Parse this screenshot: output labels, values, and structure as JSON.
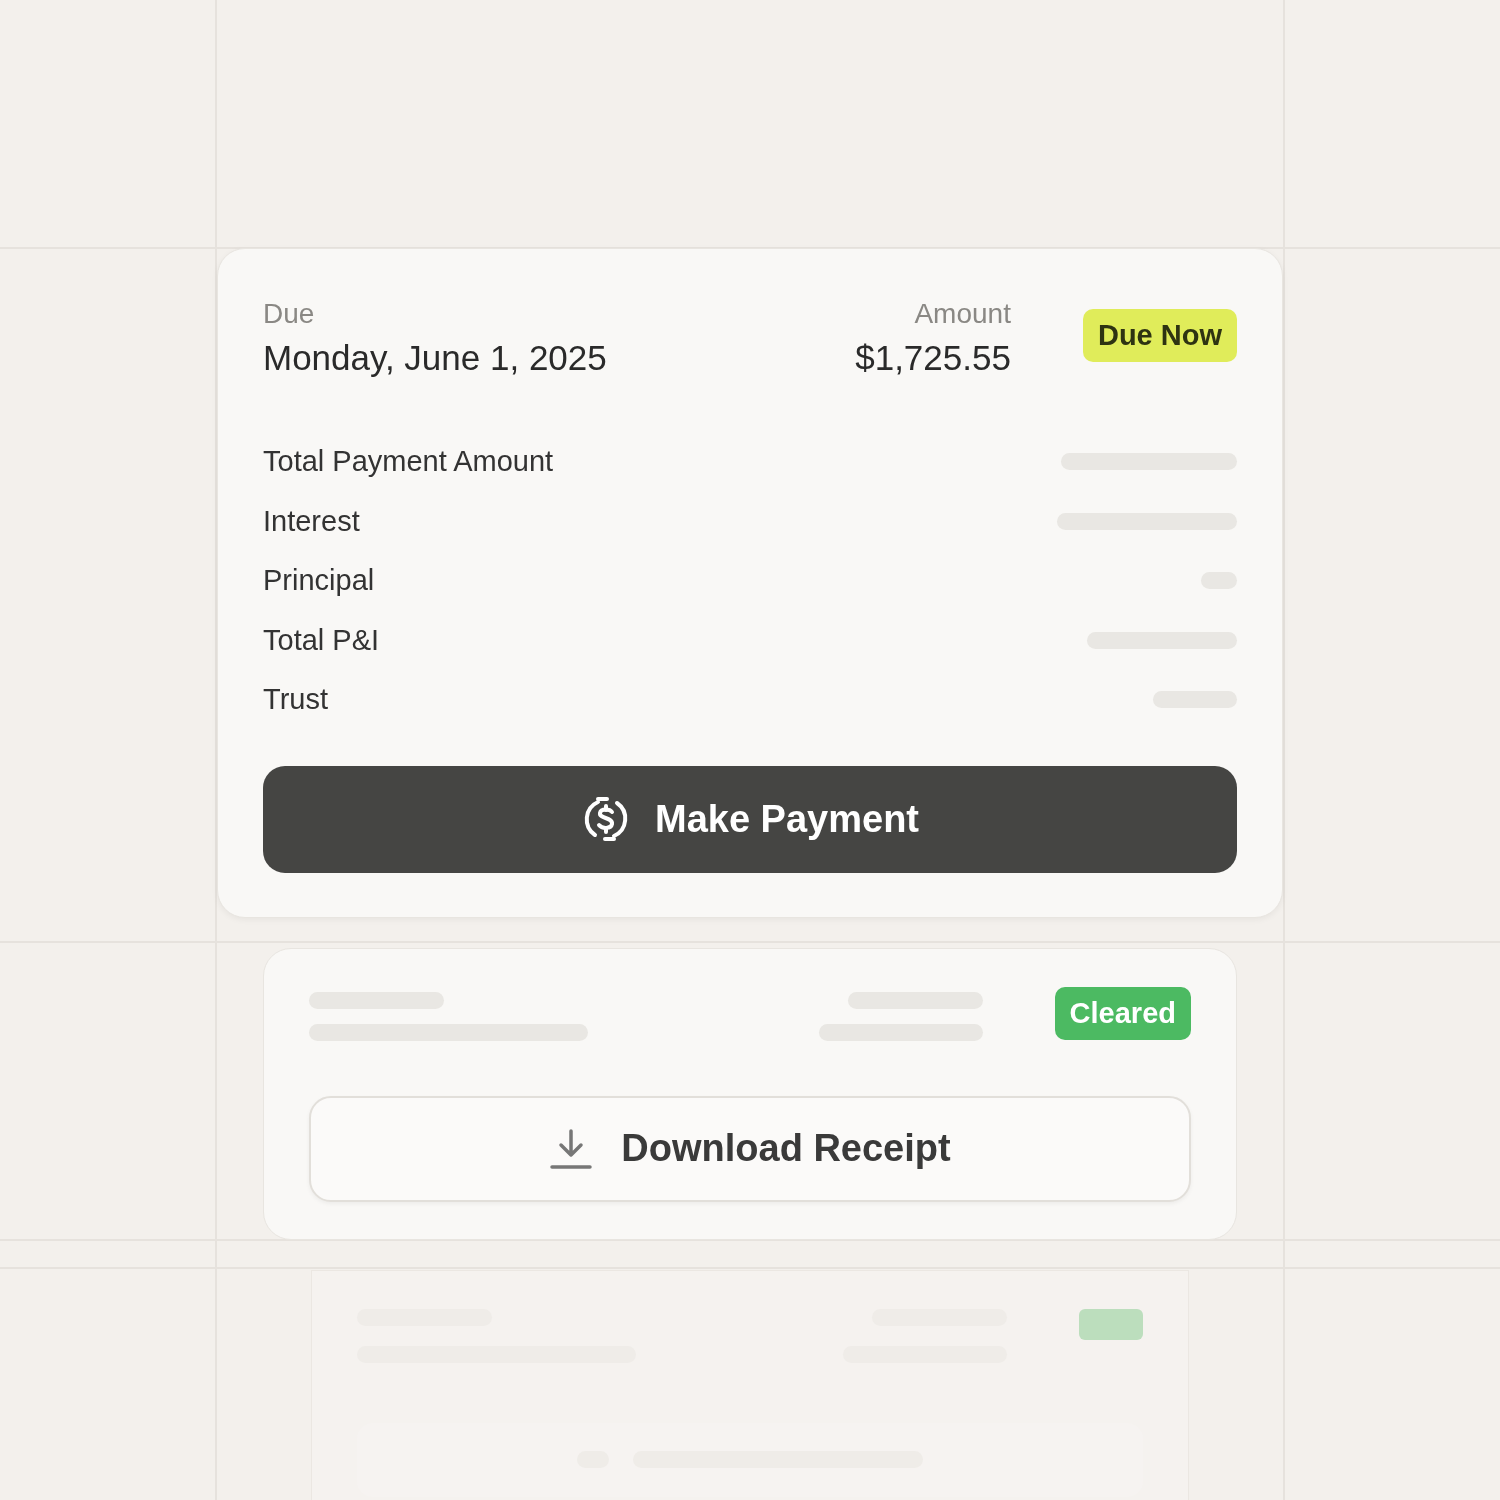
{
  "current": {
    "due_label": "Due",
    "due_date": "Monday, June 1, 2025",
    "amount_label": "Amount",
    "amount": "$1,725.55",
    "status": {
      "kind": "due",
      "label": "Due Now"
    },
    "rows": [
      {
        "label": "Total Payment Amount"
      },
      {
        "label": "Interest"
      },
      {
        "label": "Principal"
      },
      {
        "label": "Total P&I"
      },
      {
        "label": "Trust"
      }
    ],
    "button": "Make Payment"
  },
  "previous": {
    "status": {
      "kind": "cleared",
      "label": "Cleared"
    },
    "button": "Download Receipt"
  },
  "older": {
    "status": {
      "kind": "cleared"
    }
  }
}
